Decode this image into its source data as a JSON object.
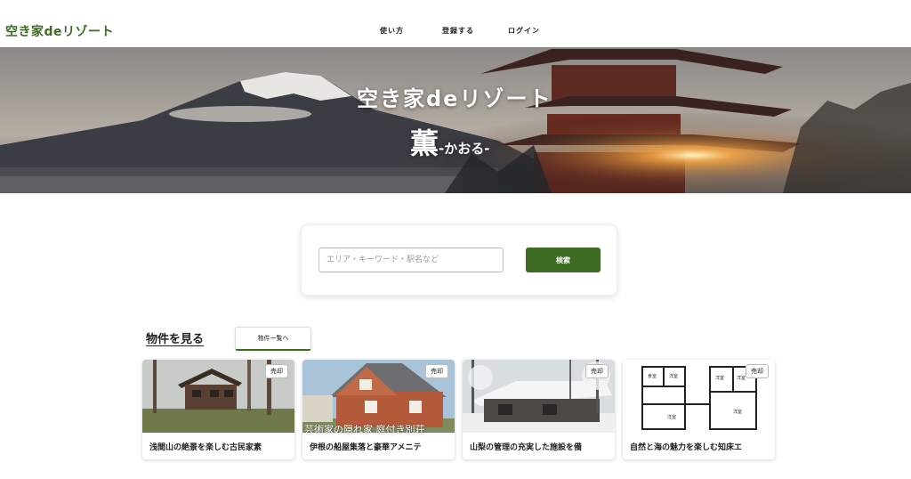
{
  "header": {
    "logo": "空き家deリゾート",
    "nav": [
      "使い方",
      "登録する",
      "ログイン"
    ]
  },
  "hero": {
    "title": "空き家deリゾート",
    "subtitle_main": "薫",
    "subtitle_reading": "-かおる-"
  },
  "search": {
    "placeholder": "エリア・キーワード・駅名など",
    "value": "",
    "button_label": "検索"
  },
  "listings_section": {
    "title": "物件を見る",
    "view_all_label": "物件一覧へ",
    "cards": [
      {
        "badge": "売却",
        "title": "浅間山の絶景を楽しむ古民家素",
        "overlay": ""
      },
      {
        "badge": "売却",
        "title": "伊根の船屋集落と豪華アメニテ",
        "overlay": "芸術家の隠れ家 庭付き別荘"
      },
      {
        "badge": "売却",
        "title": "山梨の管理の充実した施設を備",
        "overlay": ""
      },
      {
        "badge": "売却",
        "title": "自然と海の魅力を楽しむ知床エ",
        "overlay": ""
      }
    ]
  },
  "colors": {
    "brand_green": "#3d6b22",
    "text": "#222222",
    "background": "#ffffff"
  },
  "icons": []
}
